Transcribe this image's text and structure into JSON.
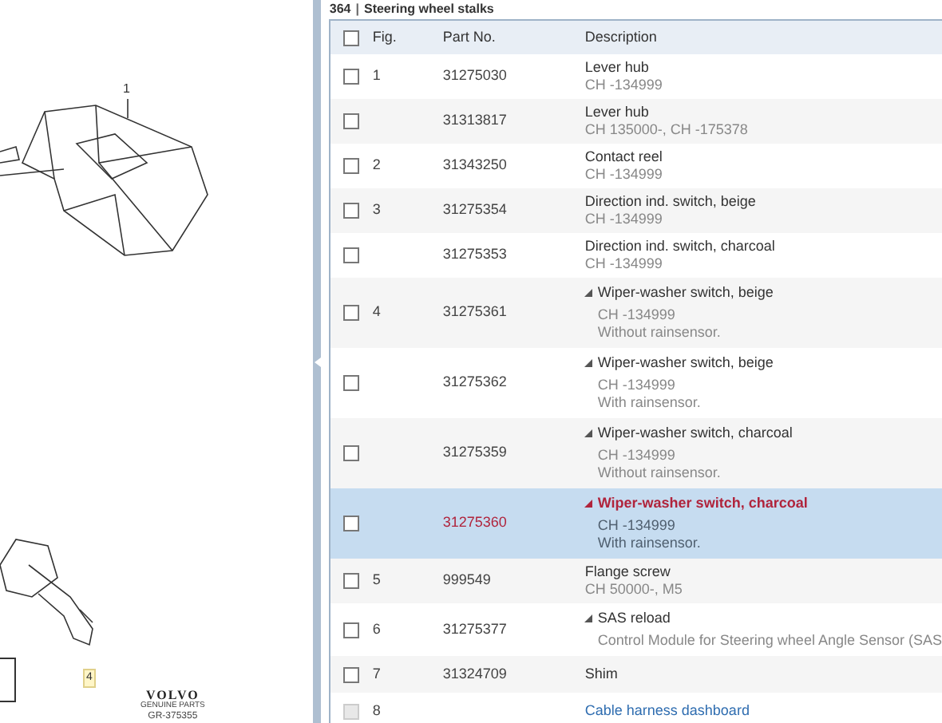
{
  "diagram": {
    "callouts": [
      "1",
      "4"
    ],
    "brand": "VOLVO",
    "brand_sub": "GENUINE PARTS",
    "ref": "GR-375355"
  },
  "section": {
    "number": "364",
    "separator": "|",
    "title": "Steering wheel stalks"
  },
  "table": {
    "columns": [
      "Fig.",
      "Part No.",
      "Description"
    ],
    "all_selected": false,
    "rows": [
      {
        "kind": "plain",
        "fig": "1",
        "part": "31275030",
        "title": "Lever hub",
        "lines": [
          "CH -134999"
        ],
        "selected": false,
        "disabled": false,
        "link": false
      },
      {
        "kind": "plain",
        "part": "31313817",
        "title": "Lever hub",
        "lines": [
          "CH 135000-, CH -175378"
        ],
        "selected": false,
        "disabled": false,
        "link": false
      },
      {
        "kind": "plain",
        "fig": "2",
        "part": "31343250",
        "title": "Contact reel",
        "lines": [
          "CH -134999"
        ],
        "selected": false,
        "disabled": false,
        "link": false
      },
      {
        "kind": "plain",
        "fig": "3",
        "part": "31275354",
        "title": "Direction ind. switch, beige",
        "lines": [
          "CH -134999"
        ],
        "selected": false,
        "disabled": false,
        "link": false
      },
      {
        "kind": "plain",
        "part": "31275353",
        "title": "Direction ind. switch, charcoal",
        "lines": [
          "CH -134999"
        ],
        "selected": false,
        "disabled": false,
        "link": false
      },
      {
        "kind": "expandable",
        "fig": "4",
        "part": "31275361",
        "title": "Wiper-washer switch, beige",
        "lines": [
          "CH -134999",
          "Without rainsensor."
        ],
        "selected": false,
        "disabled": false,
        "link": false
      },
      {
        "kind": "expandable",
        "part": "31275362",
        "title": "Wiper-washer switch, beige",
        "lines": [
          "CH -134999",
          "With rainsensor."
        ],
        "selected": false,
        "disabled": false,
        "link": false
      },
      {
        "kind": "expandable",
        "part": "31275359",
        "title": "Wiper-washer switch, charcoal",
        "lines": [
          "CH -134999",
          "Without rainsensor."
        ],
        "selected": false,
        "disabled": false,
        "link": false
      },
      {
        "kind": "expandable",
        "part": "31275360",
        "title": "Wiper-washer switch, charcoal",
        "lines": [
          "CH -134999",
          "With rainsensor."
        ],
        "selected": true,
        "disabled": false,
        "link": false
      },
      {
        "kind": "plain",
        "fig": "5",
        "part": "999549",
        "title": "Flange screw",
        "lines": [
          "CH 50000-, M5"
        ],
        "selected": false,
        "disabled": false,
        "link": false
      },
      {
        "kind": "expandable",
        "fig": "6",
        "part": "31275377",
        "title": "SAS reload",
        "lines": [
          "Control Module for Steering wheel Angle Sensor (SAS"
        ],
        "selected": false,
        "disabled": false,
        "link": false
      },
      {
        "kind": "plain",
        "fig": "7",
        "part": "31324709",
        "title": "Shim",
        "lines": [],
        "selected": false,
        "disabled": false,
        "link": false
      },
      {
        "kind": "plain",
        "fig": "8",
        "title": "Cable harness dashboard",
        "lines": [],
        "selected": false,
        "disabled": true,
        "link": true
      }
    ]
  }
}
